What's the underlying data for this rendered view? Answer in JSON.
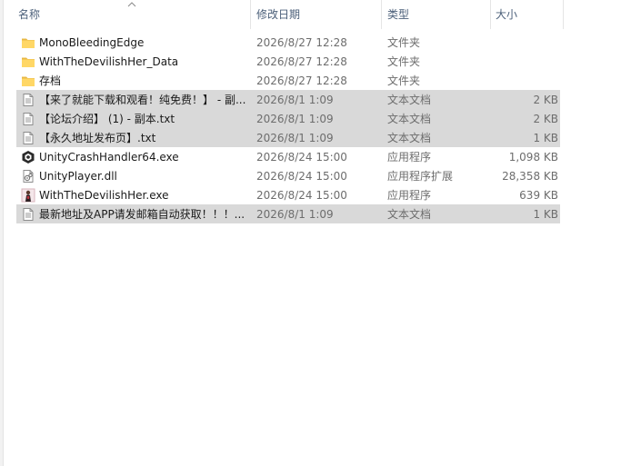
{
  "columns": {
    "name": "名称",
    "date": "修改日期",
    "type": "类型",
    "size": "大小"
  },
  "files": [
    {
      "name": "MonoBleedingEdge",
      "date": "2026/8/27 12:28",
      "type": "文件夹",
      "size": "",
      "icon": "folder-icon",
      "selected": false
    },
    {
      "name": "WithTheDevilishHer_Data",
      "date": "2026/8/27 12:28",
      "type": "文件夹",
      "size": "",
      "icon": "folder-icon",
      "selected": false
    },
    {
      "name": "存档",
      "date": "2026/8/27 12:28",
      "type": "文件夹",
      "size": "",
      "icon": "folder-icon",
      "selected": false
    },
    {
      "name": "【来了就能下载和观看！纯免费！】 - 副...",
      "date": "2026/8/1 1:09",
      "type": "文本文档",
      "size": "2 KB",
      "icon": "text-document-icon",
      "selected": true
    },
    {
      "name": "【论坛介绍】 (1) - 副本.txt",
      "date": "2026/8/1 1:09",
      "type": "文本文档",
      "size": "2 KB",
      "icon": "text-document-icon",
      "selected": true
    },
    {
      "name": "【永久地址发布页】.txt",
      "date": "2026/8/1 1:09",
      "type": "文本文档",
      "size": "1 KB",
      "icon": "text-document-icon",
      "selected": true
    },
    {
      "name": "UnityCrashHandler64.exe",
      "date": "2026/8/24 15:00",
      "type": "应用程序",
      "size": "1,098 KB",
      "icon": "unity-app-icon",
      "selected": false
    },
    {
      "name": "UnityPlayer.dll",
      "date": "2026/8/24 15:00",
      "type": "应用程序扩展",
      "size": "28,358 KB",
      "icon": "dll-file-icon",
      "selected": false
    },
    {
      "name": "WithTheDevilishHer.exe",
      "date": "2026/8/24 15:00",
      "type": "应用程序",
      "size": "639 KB",
      "icon": "game-exe-icon",
      "selected": false
    },
    {
      "name": "最新地址及APP请发邮箱自动获取！！！...",
      "date": "2026/8/1 1:09",
      "type": "文本文档",
      "size": "1 KB",
      "icon": "text-document-icon",
      "selected": true
    }
  ]
}
